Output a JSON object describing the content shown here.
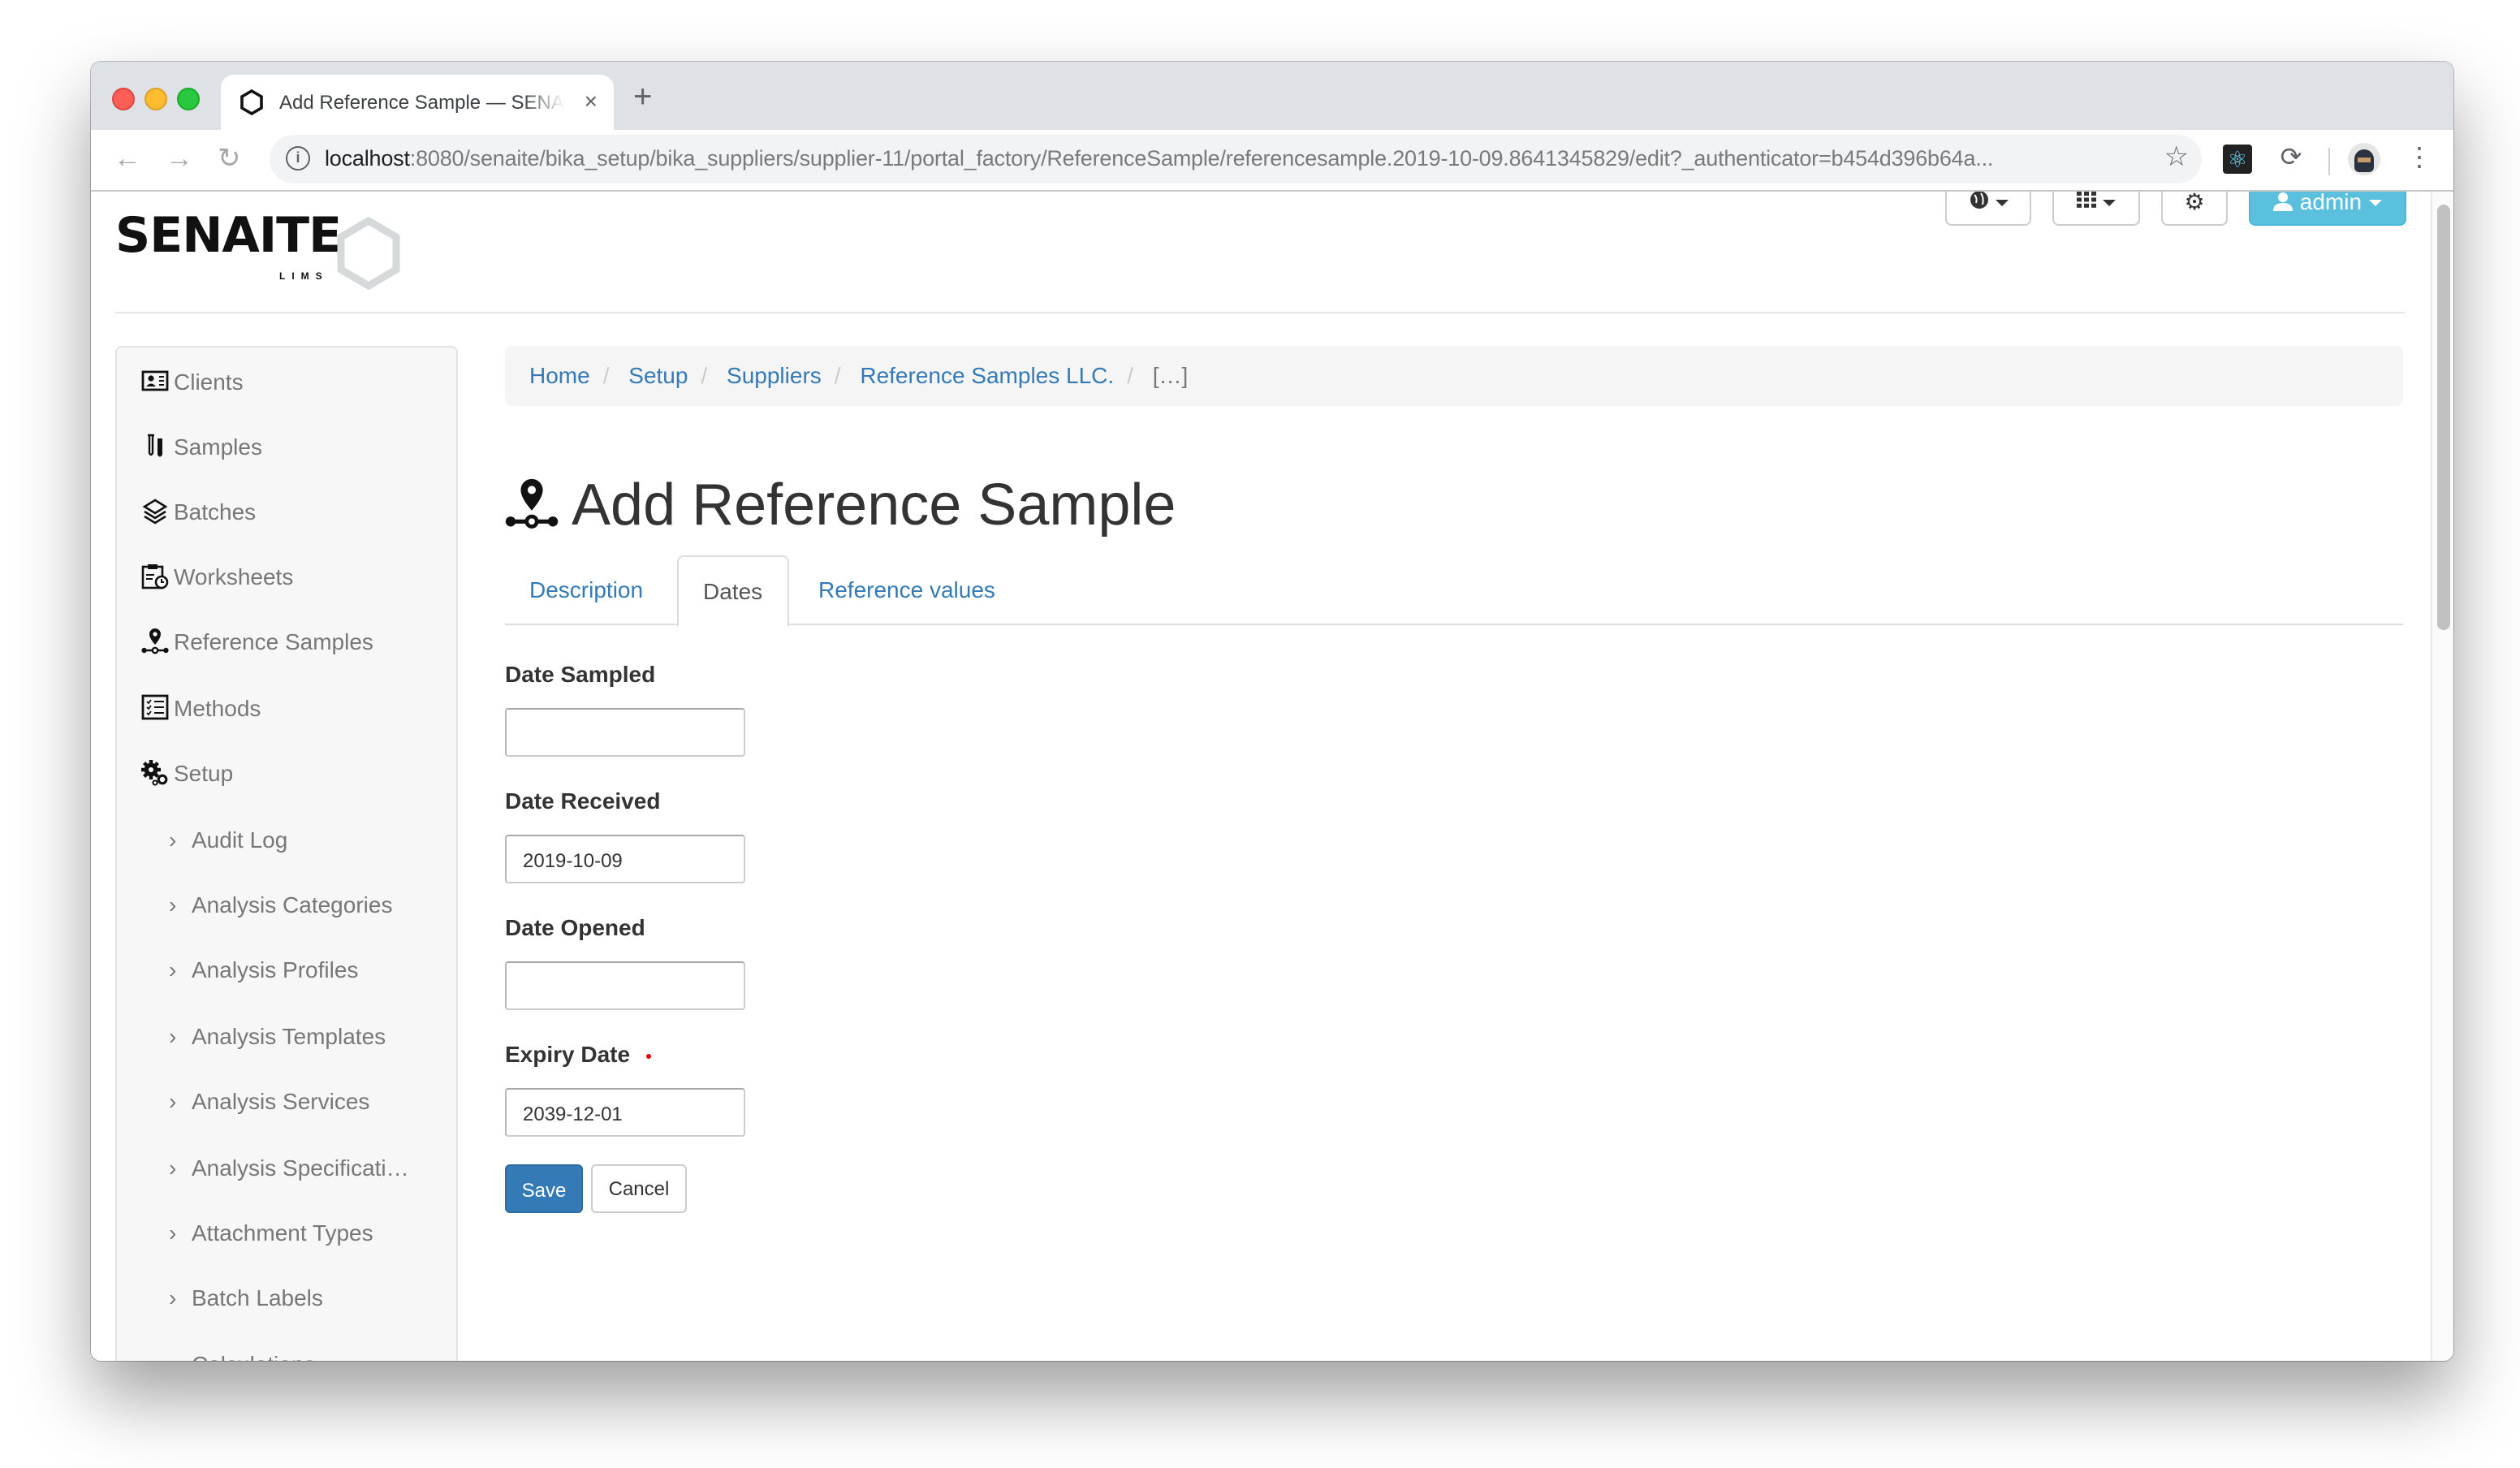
{
  "browser": {
    "tab": {
      "title": "Add Reference Sample — SENAITE",
      "favicon": "hexagon-icon"
    },
    "new_tab_label": "+",
    "close_tab_label": "×",
    "url": {
      "host": "localhost",
      "rest": ":8080/senaite/bika_setup/bika_suppliers/supplier-11/portal_factory/ReferenceSample/referencesample.2019-10-09.8641345829/edit?_authenticator=b454d396b64a..."
    },
    "toolbar_icons": [
      "back-icon",
      "forward-icon",
      "reload-icon",
      "info-icon",
      "star-icon",
      "react-devtools-icon",
      "sync-extension-icon",
      "profile-avatar",
      "kebab-menu-icon"
    ]
  },
  "header": {
    "logo_text": "SENAITE",
    "logo_sub": "LIMS",
    "user_label": "admin",
    "buttons": [
      "language-menu",
      "apps-menu",
      "site-setup",
      "user-menu"
    ]
  },
  "sidebar": {
    "items": [
      {
        "label": "Clients",
        "icon": "client-card-icon"
      },
      {
        "label": "Samples",
        "icon": "test-tubes-icon"
      },
      {
        "label": "Batches",
        "icon": "layers-icon"
      },
      {
        "label": "Worksheets",
        "icon": "clipboard-clock-icon"
      },
      {
        "label": "Reference Samples",
        "icon": "reference-sample-icon"
      },
      {
        "label": "Methods",
        "icon": "checklist-icon"
      },
      {
        "label": "Setup",
        "icon": "gears-icon"
      }
    ],
    "setup_children": [
      "Audit Log",
      "Analysis Categories",
      "Analysis Profiles",
      "Analysis Templates",
      "Analysis Services",
      "Analysis Specificati…",
      "Attachment Types",
      "Batch Labels",
      "Calculations"
    ]
  },
  "breadcrumb": {
    "items": [
      "Home",
      "Setup",
      "Suppliers",
      "Reference Samples LLC."
    ],
    "current": "[…]"
  },
  "page": {
    "title": "Add Reference Sample",
    "tabs": [
      {
        "label": "Description",
        "active": false
      },
      {
        "label": "Dates",
        "active": true
      },
      {
        "label": "Reference values",
        "active": false
      }
    ]
  },
  "form": {
    "fields": [
      {
        "label": "Date Sampled",
        "value": "",
        "required": false
      },
      {
        "label": "Date Received",
        "value": "2019-10-09",
        "required": false
      },
      {
        "label": "Date Opened",
        "value": "",
        "required": false
      },
      {
        "label": "Expiry Date",
        "value": "2039-12-01",
        "required": true
      }
    ],
    "save_label": "Save",
    "cancel_label": "Cancel"
  },
  "colors": {
    "link": "#337ab7",
    "primary_button": "#337ab7",
    "admin_button": "#5bc0de",
    "required_marker": "#ee0000"
  }
}
